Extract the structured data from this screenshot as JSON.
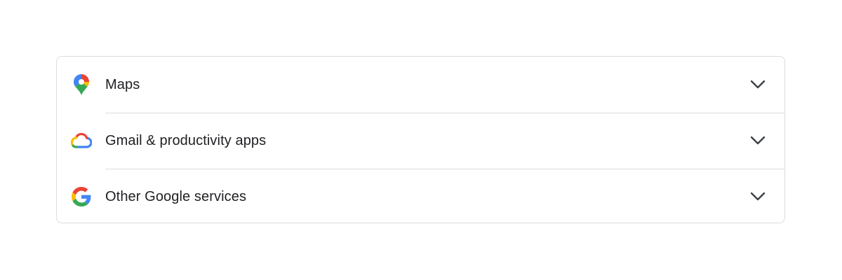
{
  "sections": [
    {
      "label": "Maps",
      "icon": "google-maps-pin-icon"
    },
    {
      "label": "Gmail & productivity apps",
      "icon": "google-cloud-icon"
    },
    {
      "label": "Other Google services",
      "icon": "google-g-icon"
    }
  ],
  "expand_icon": "chevron-down-icon",
  "colors": {
    "border": "#dadce0",
    "text": "#202124",
    "chevron": "#3c4043",
    "google_blue": "#4285F4",
    "google_red": "#EA4335",
    "google_yellow": "#FBBC04",
    "google_green": "#34A853"
  }
}
